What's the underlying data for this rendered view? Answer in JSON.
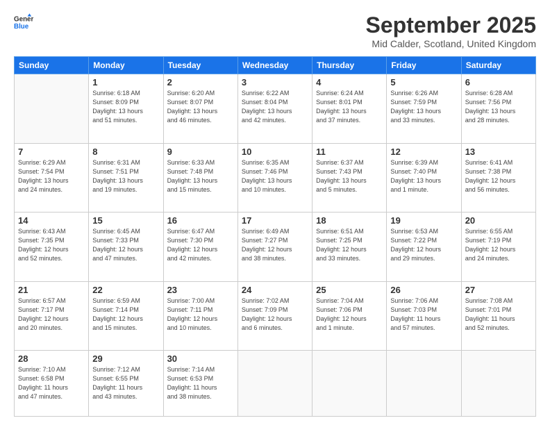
{
  "header": {
    "logo_general": "General",
    "logo_blue": "Blue",
    "month": "September 2025",
    "location": "Mid Calder, Scotland, United Kingdom"
  },
  "weekdays": [
    "Sunday",
    "Monday",
    "Tuesday",
    "Wednesday",
    "Thursday",
    "Friday",
    "Saturday"
  ],
  "weeks": [
    [
      {
        "day": "",
        "info": ""
      },
      {
        "day": "1",
        "info": "Sunrise: 6:18 AM\nSunset: 8:09 PM\nDaylight: 13 hours\nand 51 minutes."
      },
      {
        "day": "2",
        "info": "Sunrise: 6:20 AM\nSunset: 8:07 PM\nDaylight: 13 hours\nand 46 minutes."
      },
      {
        "day": "3",
        "info": "Sunrise: 6:22 AM\nSunset: 8:04 PM\nDaylight: 13 hours\nand 42 minutes."
      },
      {
        "day": "4",
        "info": "Sunrise: 6:24 AM\nSunset: 8:01 PM\nDaylight: 13 hours\nand 37 minutes."
      },
      {
        "day": "5",
        "info": "Sunrise: 6:26 AM\nSunset: 7:59 PM\nDaylight: 13 hours\nand 33 minutes."
      },
      {
        "day": "6",
        "info": "Sunrise: 6:28 AM\nSunset: 7:56 PM\nDaylight: 13 hours\nand 28 minutes."
      }
    ],
    [
      {
        "day": "7",
        "info": "Sunrise: 6:29 AM\nSunset: 7:54 PM\nDaylight: 13 hours\nand 24 minutes."
      },
      {
        "day": "8",
        "info": "Sunrise: 6:31 AM\nSunset: 7:51 PM\nDaylight: 13 hours\nand 19 minutes."
      },
      {
        "day": "9",
        "info": "Sunrise: 6:33 AM\nSunset: 7:48 PM\nDaylight: 13 hours\nand 15 minutes."
      },
      {
        "day": "10",
        "info": "Sunrise: 6:35 AM\nSunset: 7:46 PM\nDaylight: 13 hours\nand 10 minutes."
      },
      {
        "day": "11",
        "info": "Sunrise: 6:37 AM\nSunset: 7:43 PM\nDaylight: 13 hours\nand 5 minutes."
      },
      {
        "day": "12",
        "info": "Sunrise: 6:39 AM\nSunset: 7:40 PM\nDaylight: 13 hours\nand 1 minute."
      },
      {
        "day": "13",
        "info": "Sunrise: 6:41 AM\nSunset: 7:38 PM\nDaylight: 12 hours\nand 56 minutes."
      }
    ],
    [
      {
        "day": "14",
        "info": "Sunrise: 6:43 AM\nSunset: 7:35 PM\nDaylight: 12 hours\nand 52 minutes."
      },
      {
        "day": "15",
        "info": "Sunrise: 6:45 AM\nSunset: 7:33 PM\nDaylight: 12 hours\nand 47 minutes."
      },
      {
        "day": "16",
        "info": "Sunrise: 6:47 AM\nSunset: 7:30 PM\nDaylight: 12 hours\nand 42 minutes."
      },
      {
        "day": "17",
        "info": "Sunrise: 6:49 AM\nSunset: 7:27 PM\nDaylight: 12 hours\nand 38 minutes."
      },
      {
        "day": "18",
        "info": "Sunrise: 6:51 AM\nSunset: 7:25 PM\nDaylight: 12 hours\nand 33 minutes."
      },
      {
        "day": "19",
        "info": "Sunrise: 6:53 AM\nSunset: 7:22 PM\nDaylight: 12 hours\nand 29 minutes."
      },
      {
        "day": "20",
        "info": "Sunrise: 6:55 AM\nSunset: 7:19 PM\nDaylight: 12 hours\nand 24 minutes."
      }
    ],
    [
      {
        "day": "21",
        "info": "Sunrise: 6:57 AM\nSunset: 7:17 PM\nDaylight: 12 hours\nand 20 minutes."
      },
      {
        "day": "22",
        "info": "Sunrise: 6:59 AM\nSunset: 7:14 PM\nDaylight: 12 hours\nand 15 minutes."
      },
      {
        "day": "23",
        "info": "Sunrise: 7:00 AM\nSunset: 7:11 PM\nDaylight: 12 hours\nand 10 minutes."
      },
      {
        "day": "24",
        "info": "Sunrise: 7:02 AM\nSunset: 7:09 PM\nDaylight: 12 hours\nand 6 minutes."
      },
      {
        "day": "25",
        "info": "Sunrise: 7:04 AM\nSunset: 7:06 PM\nDaylight: 12 hours\nand 1 minute."
      },
      {
        "day": "26",
        "info": "Sunrise: 7:06 AM\nSunset: 7:03 PM\nDaylight: 11 hours\nand 57 minutes."
      },
      {
        "day": "27",
        "info": "Sunrise: 7:08 AM\nSunset: 7:01 PM\nDaylight: 11 hours\nand 52 minutes."
      }
    ],
    [
      {
        "day": "28",
        "info": "Sunrise: 7:10 AM\nSunset: 6:58 PM\nDaylight: 11 hours\nand 47 minutes."
      },
      {
        "day": "29",
        "info": "Sunrise: 7:12 AM\nSunset: 6:55 PM\nDaylight: 11 hours\nand 43 minutes."
      },
      {
        "day": "30",
        "info": "Sunrise: 7:14 AM\nSunset: 6:53 PM\nDaylight: 11 hours\nand 38 minutes."
      },
      {
        "day": "",
        "info": ""
      },
      {
        "day": "",
        "info": ""
      },
      {
        "day": "",
        "info": ""
      },
      {
        "day": "",
        "info": ""
      }
    ]
  ]
}
